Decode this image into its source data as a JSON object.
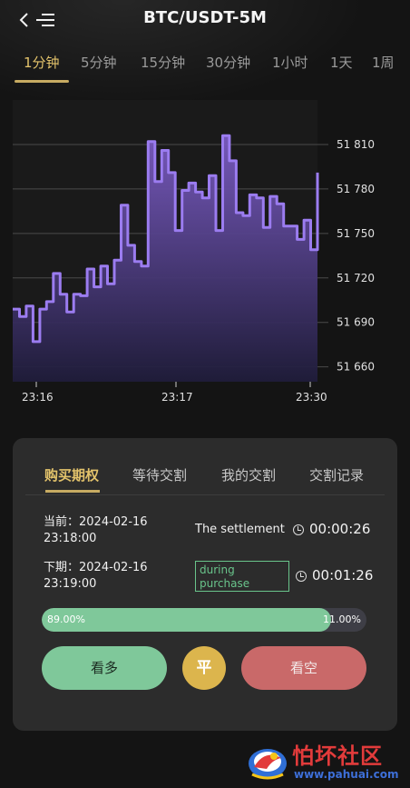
{
  "header": {
    "title": "BTC/USDT-5M",
    "back_icon": "chevron-left-icon",
    "menu_icon": "list-menu-icon"
  },
  "timeframes": [
    "1分钟",
    "5分钟",
    "15分钟",
    "30分钟",
    "1小时",
    "1天",
    "1周"
  ],
  "active_timeframe": "1分钟",
  "chart_data": {
    "type": "area",
    "title": "",
    "xlabel": "",
    "ylabel": "",
    "ylim": [
      51650,
      51840
    ],
    "y_ticks": [
      "51 810",
      "51 780",
      "51 750",
      "51 720",
      "51 690",
      "51 660"
    ],
    "x_ticks": [
      "23:16",
      "23:17",
      "23:30"
    ],
    "series": [
      {
        "values": [
          51699,
          51694,
          51701,
          51677,
          51699,
          51704,
          51723,
          51709,
          51697,
          51709,
          51708,
          51726,
          51714,
          51728,
          51716,
          51732,
          51769,
          51742,
          51731,
          51728,
          51812,
          51785,
          51806,
          51791,
          51752,
          51779,
          51784,
          51778,
          51774,
          51789,
          51752,
          51816,
          51799,
          51764,
          51762,
          51776,
          51774,
          51754,
          51775,
          51770,
          51755,
          51755,
          51746,
          51759,
          51739,
          51791
        ]
      }
    ],
    "line_color": "#9b7cf0",
    "fill_top": "#7a5bc2",
    "fill_bottom": "#1f1c3a",
    "grid": true
  },
  "trade_tabs": [
    "购买期权",
    "等待交割",
    "我的交割",
    "交割记录"
  ],
  "active_trade_tab": "购买期权",
  "current_period": {
    "label": "当前：2024-02-16",
    "time": "23:18:00",
    "status": "The settlement",
    "countdown": "00:00:26"
  },
  "next_period": {
    "label": "下期：2024-02-16",
    "time": "23:19:00",
    "status": "during purchase",
    "countdown": "00:01:26"
  },
  "ratio": {
    "left_value": 0.89,
    "left_text": "89.00%",
    "right_text": "11.00%"
  },
  "actions": {
    "up_label": "看多",
    "flat_label": "平",
    "down_label": "看空",
    "up_color": "#7fc89a",
    "flat_color": "#dcb54d",
    "down_color": "#c96969"
  },
  "watermark": {
    "text": "怕坏社区",
    "url": "www.pahuai.com"
  }
}
